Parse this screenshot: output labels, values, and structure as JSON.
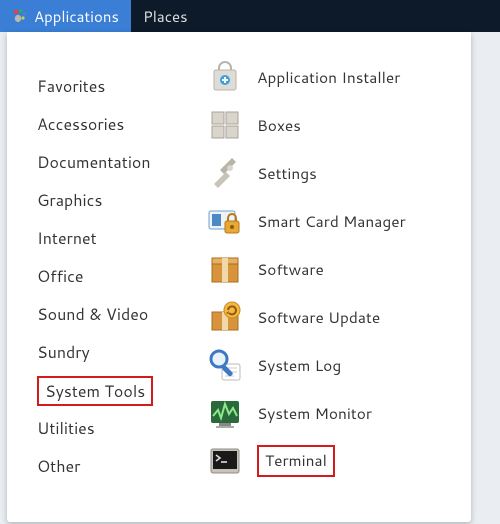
{
  "menubar": {
    "applications": "Applications",
    "places": "Places"
  },
  "categories": [
    {
      "label": "Favorites"
    },
    {
      "label": "Accessories"
    },
    {
      "label": "Documentation"
    },
    {
      "label": "Graphics"
    },
    {
      "label": "Internet"
    },
    {
      "label": "Office"
    },
    {
      "label": "Sound & Video"
    },
    {
      "label": "Sundry"
    },
    {
      "label": "System Tools",
      "highlighted": true
    },
    {
      "label": "Utilities"
    },
    {
      "label": "Other"
    }
  ],
  "apps": [
    {
      "label": "Application Installer",
      "icon": "shopping-bag-icon"
    },
    {
      "label": "Boxes",
      "icon": "boxes-icon"
    },
    {
      "label": "Settings",
      "icon": "settings-wrench-icon"
    },
    {
      "label": "Smart Card Manager",
      "icon": "smartcard-lock-icon"
    },
    {
      "label": "Software",
      "icon": "package-icon"
    },
    {
      "label": "Software Update",
      "icon": "package-update-icon"
    },
    {
      "label": "System Log",
      "icon": "magnifier-log-icon"
    },
    {
      "label": "System Monitor",
      "icon": "system-monitor-icon"
    },
    {
      "label": "Terminal",
      "icon": "terminal-icon",
      "highlighted": true
    }
  ],
  "colors": {
    "menubar_bg": "#0d1a2a",
    "menubar_active_bg": "#3a7fd5",
    "highlight_border": "#d21c1c"
  }
}
